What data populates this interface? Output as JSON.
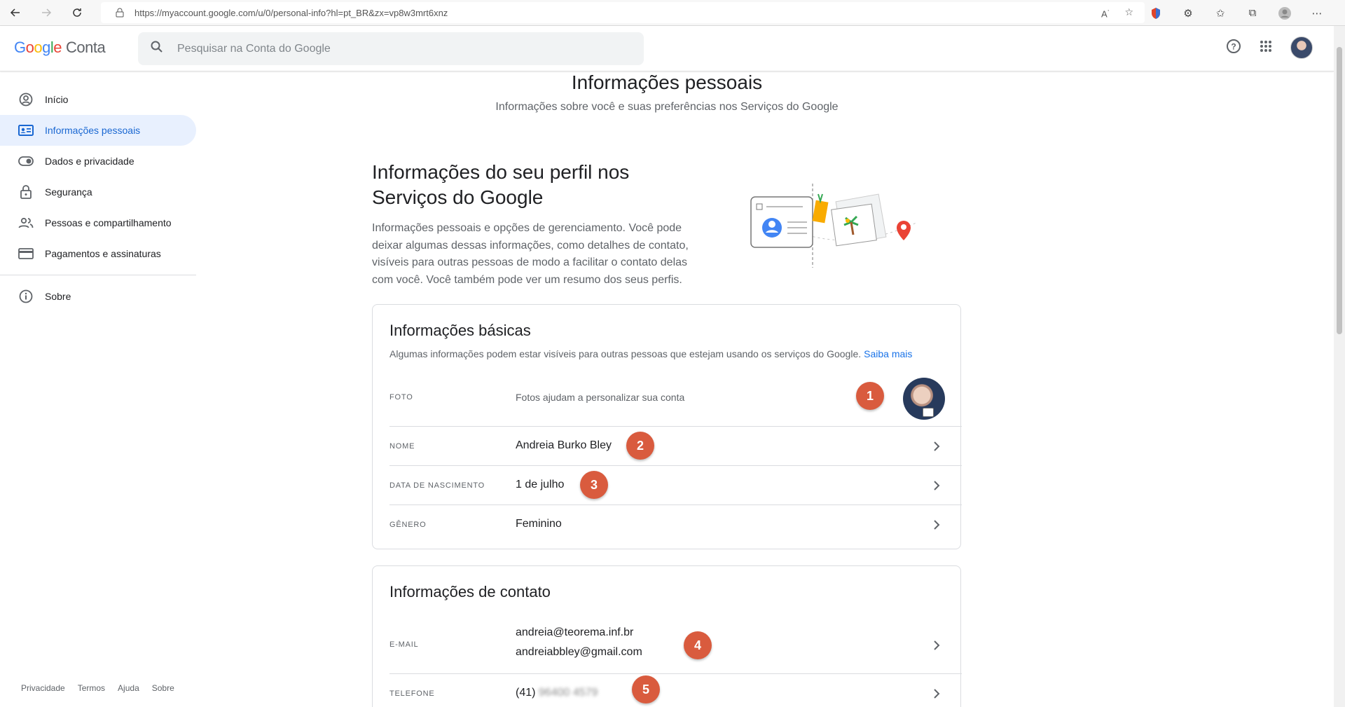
{
  "browser": {
    "url": "https://myaccount.google.com/u/0/personal-info?hl=pt_BR&zx=vp8w3mrt6xnz",
    "url_host_bold": "myaccount.google.com"
  },
  "header": {
    "logo_word": "Google",
    "logo_suffix": "Conta",
    "search_placeholder": "Pesquisar na Conta do Google"
  },
  "sidebar": {
    "items": [
      {
        "label": "Início",
        "icon": "account-circle-icon"
      },
      {
        "label": "Informações pessoais",
        "icon": "id-card-icon",
        "active": true
      },
      {
        "label": "Dados e privacidade",
        "icon": "toggle-icon"
      },
      {
        "label": "Segurança",
        "icon": "lock-icon"
      },
      {
        "label": "Pessoas e compartilhamento",
        "icon": "people-icon"
      },
      {
        "label": "Pagamentos e assinaturas",
        "icon": "credit-card-icon"
      },
      {
        "label": "Sobre",
        "icon": "info-icon"
      }
    ],
    "footer": [
      "Privacidade",
      "Termos",
      "Ajuda",
      "Sobre"
    ]
  },
  "main": {
    "title": "Informações pessoais",
    "subtitle": "Informações sobre você e suas preferências nos Serviços do Google",
    "section_title": "Informações do seu perfil nos Serviços do Google",
    "section_desc": "Informações pessoais e opções de gerenciamento. Você pode deixar algumas dessas informações, como detalhes de contato, visíveis para outras pessoas de modo a facilitar o contato delas com você. Você também pode ver um resumo dos seus perfis."
  },
  "basic_info": {
    "title": "Informações básicas",
    "desc": "Algumas informações podem estar visíveis para outras pessoas que estejam usando os serviços do Google.",
    "learn_more": "Saiba mais",
    "rows": {
      "photo": {
        "label": "FOTO",
        "value": "Fotos ajudam a personalizar sua conta"
      },
      "name": {
        "label": "NOME",
        "value": "Andreia Burko Bley"
      },
      "birthday": {
        "label": "DATA DE NASCIMENTO",
        "value": "1 de julho"
      },
      "gender": {
        "label": "GÊNERO",
        "value": "Feminino"
      }
    }
  },
  "contact_info": {
    "title": "Informações de contato",
    "rows": {
      "email": {
        "label": "E-MAIL",
        "values": [
          "andreia@teorema.inf.br",
          "andreiabbley@gmail.com"
        ]
      },
      "phone": {
        "label": "TELEFONE",
        "prefix": "(41)",
        "hidden": "96400 4579"
      }
    }
  },
  "badges": [
    "1",
    "2",
    "3",
    "4",
    "5"
  ],
  "colors": {
    "accent": "#1a73e8",
    "active_bg": "#e8f0fe",
    "badge": "#d95b3e"
  }
}
